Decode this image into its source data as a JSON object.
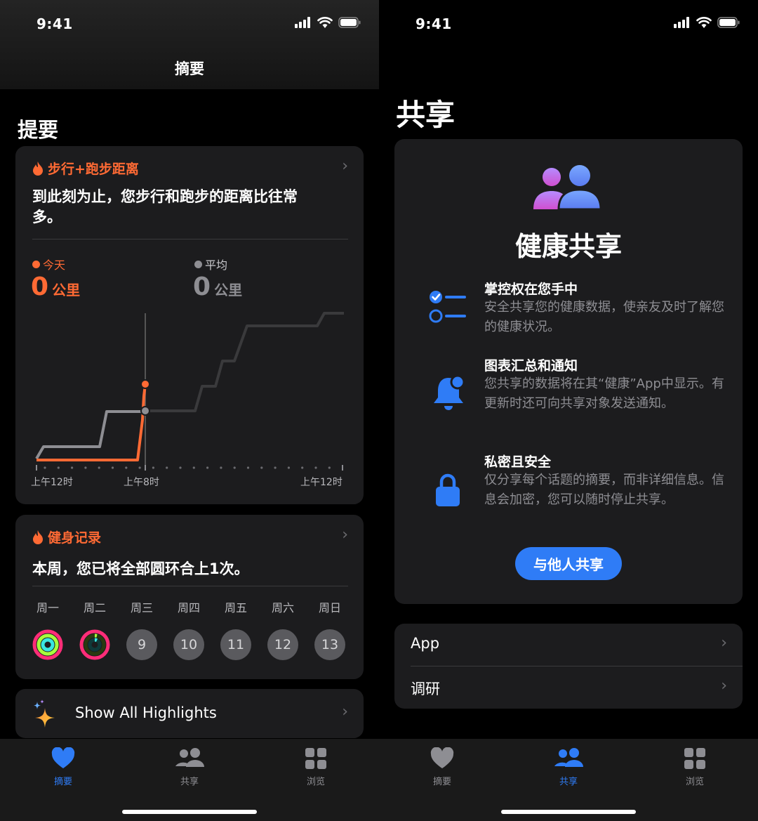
{
  "summary_screen": {
    "status_time": "9:41",
    "nav_title": "摘要",
    "section_title": "提要",
    "distance_card": {
      "title": "步行+跑步距离",
      "message": "到此刻为止，您步行和跑步的距离比往常多。",
      "today_label": "今天",
      "today_value": "0",
      "today_unit": "公里",
      "avg_label": "平均",
      "avg_value": "0",
      "avg_unit": "公里",
      "axis_labels": [
        "上午12时",
        "上午8时",
        "上午12时"
      ],
      "colors": {
        "today": "#ff6a34",
        "average": "#8e8e93"
      }
    },
    "fitness_card": {
      "title": "健身记录",
      "message": "本周，您已将全部圆环合上1次。",
      "days": [
        {
          "name": "周一",
          "ring": "closed"
        },
        {
          "name": "周二",
          "ring": "partial"
        },
        {
          "name": "周三",
          "number": "9"
        },
        {
          "name": "周四",
          "number": "10"
        },
        {
          "name": "周五",
          "number": "11"
        },
        {
          "name": "周六",
          "number": "12"
        },
        {
          "name": "周日",
          "number": "13"
        }
      ]
    },
    "highlights_label": "Show All Highlights",
    "tabs": [
      {
        "label": "摘要",
        "icon": "heart-icon",
        "active": true
      },
      {
        "label": "共享",
        "icon": "people-icon",
        "active": false
      },
      {
        "label": "浏览",
        "icon": "grid-icon",
        "active": false
      }
    ]
  },
  "sharing_screen": {
    "status_time": "9:41",
    "page_title": "共享",
    "hero_title": "健康共享",
    "features": [
      {
        "icon": "checklist-icon",
        "title": "掌控权在您手中",
        "desc": "安全共享您的健康数据，使亲友及时了解您的健康状况。"
      },
      {
        "icon": "bell-icon",
        "title": "图表汇总和通知",
        "desc": "您共享的数据将在其“健康”App中显示。有更新时还可向共享对象发送通知。"
      },
      {
        "icon": "lock-icon",
        "title": "私密且安全",
        "desc": "仅分享每个话题的摘要，而非详细信息。信息会加密，您可以随时停止共享。"
      }
    ],
    "share_button": "与他人共享",
    "list_items": [
      "App",
      "调研"
    ],
    "tabs": [
      {
        "label": "摘要",
        "icon": "heart-icon",
        "active": false
      },
      {
        "label": "共享",
        "icon": "people-icon",
        "active": true
      },
      {
        "label": "浏览",
        "icon": "grid-icon",
        "active": false
      }
    ]
  },
  "accent_color": "#2f7cf6"
}
